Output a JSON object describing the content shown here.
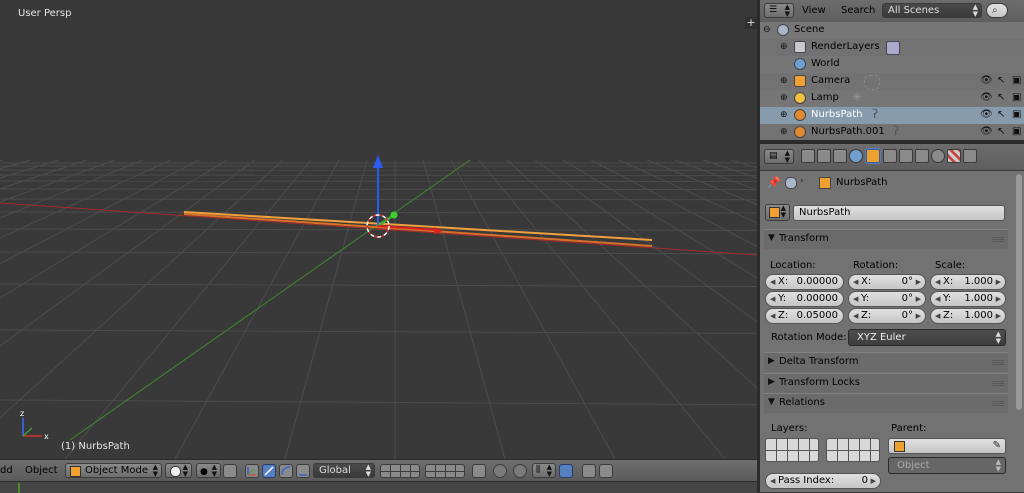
{
  "viewport": {
    "title": "User Persp",
    "object_label": "(1) NurbsPath",
    "corner_button": "+",
    "colors": {
      "background": "#393939",
      "grid": "#4d4d4d",
      "x_axis": "#b22626",
      "y_axis": "#4d9a32",
      "curve_selected": "#f7a83c",
      "curve_unselected": "#e07a2a",
      "gizmo_z": "#2a5cf0"
    }
  },
  "header": {
    "menu_partial": "dd",
    "object_menu": "Object",
    "mode_select": "Object Mode",
    "orientation_select": "Global",
    "icons": [
      "editor-type-icon",
      "viewport-shading-icon",
      "pivot-point-icon",
      "manipulator-toggle-icon",
      "translate-icon",
      "rotate-icon",
      "layers-grid",
      "render-layer-icon",
      "proportional-edit-icon",
      "snap-icon",
      "opengl-render-icon",
      "camera-icon"
    ]
  },
  "outliner": {
    "header": {
      "view": "View",
      "search": "Search",
      "scene_filter": "All Scenes",
      "search_icon": "search-icon"
    },
    "items": [
      {
        "label": "Scene",
        "icon": "scene-icon"
      },
      {
        "label": "RenderLayers",
        "icon": "render-layers-icon"
      },
      {
        "label": "World",
        "icon": "world-icon"
      },
      {
        "label": "Camera",
        "icon": "camera-object-icon"
      },
      {
        "label": "Lamp",
        "icon": "lamp-object-icon"
      },
      {
        "label": "NurbsPath",
        "icon": "curve-object-icon"
      },
      {
        "label": "NurbsPath.001",
        "icon": "curve-object-icon"
      }
    ]
  },
  "properties": {
    "breadcrumb": "NurbsPath",
    "object_name": "NurbsPath",
    "panels": {
      "transform": "Transform",
      "delta_transform": "Delta Transform",
      "transform_locks": "Transform Locks",
      "relations": "Relations"
    },
    "location": {
      "label": "Location:",
      "x": {
        "axis": "X:",
        "value": "0.00000"
      },
      "y": {
        "axis": "Y:",
        "value": "0.00000"
      },
      "z": {
        "axis": "Z:",
        "value": "0.05000"
      }
    },
    "rotation": {
      "label": "Rotation:",
      "x": {
        "axis": "X:",
        "value": "0°"
      },
      "y": {
        "axis": "Y:",
        "value": "0°"
      },
      "z": {
        "axis": "Z:",
        "value": "0°"
      }
    },
    "scale": {
      "label": "Scale:",
      "x": {
        "axis": "X:",
        "value": "1.000"
      },
      "y": {
        "axis": "Y:",
        "value": "1.000"
      },
      "z": {
        "axis": "Z:",
        "value": "1.000"
      }
    },
    "rotation_mode": {
      "label": "Rotation Mode:",
      "value": "XYZ Euler"
    },
    "relations": {
      "layers_label": "Layers:",
      "parent_label": "Parent:",
      "parent_type": "Object",
      "pass_index_label": "Pass Index:",
      "pass_index_value": "0"
    }
  }
}
